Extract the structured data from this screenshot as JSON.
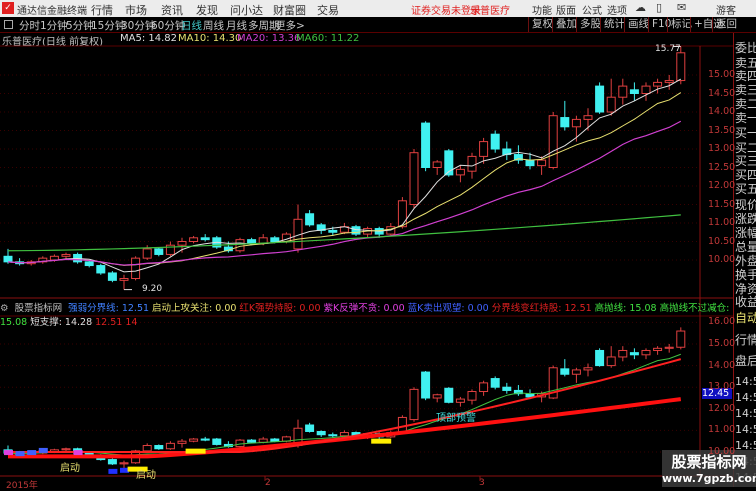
{
  "menubar": {
    "logo_icon": "tdx-logo-icon",
    "app_title": "通达信金融终端",
    "menus": [
      "行情",
      "市场",
      "资讯",
      "发现",
      "问小达",
      "财富圈",
      "交易"
    ],
    "login_status": "证券交易未登录",
    "stock_name": "乐普医疗",
    "right_menus": [
      "功能",
      "版面",
      "公式",
      "选项"
    ],
    "icons": [
      "cloud-icon",
      "phone-icon",
      "message-icon"
    ],
    "user": "游客"
  },
  "toolbar": {
    "periods": [
      "分时",
      "1分钟",
      "5分钟",
      "15分钟",
      "30分钟",
      "60分钟",
      "日线",
      "周线",
      "月线",
      "多周期",
      "更多>"
    ],
    "active_period": "日线",
    "buttons": [
      "复权",
      "叠加",
      "多股",
      "统计",
      "画线",
      "F10",
      "标记",
      "+自选",
      "返回"
    ]
  },
  "info": {
    "title": "乐普医疗(日线 前复权)",
    "ma5": "MA5: 14.82",
    "ma10": "MA10: 14.30",
    "ma20": "MA20: 13.36",
    "ma60": "MA60: 11.22"
  },
  "colors": {
    "up": "#e04040",
    "down": "#40f0f0",
    "ma5": "#e0e0e0",
    "ma10": "#e8e070",
    "ma20": "#d040d0",
    "ma60": "#40c040",
    "axis": "#c03838",
    "grid": "#3a0000"
  },
  "right_panel": {
    "top": [
      "委比",
      "卖五",
      "卖四",
      "卖三",
      "卖二",
      "卖一",
      "买一",
      "买二",
      "买三",
      "买四",
      "买五",
      "现价",
      "涨跌",
      "涨幅",
      "总量",
      "外盘",
      "换手",
      "净资",
      "收益"
    ],
    "bottom": [
      "自动",
      "行情",
      "盘后"
    ],
    "times": [
      "14:56",
      "14:56",
      "14:56",
      "14:56",
      "14:56",
      "14:56",
      "14:57",
      "15:00"
    ]
  },
  "indicator": {
    "name": "股票指标网",
    "items": [
      {
        "t": "强弱分界线: 12.51",
        "c": "#4080ff"
      },
      {
        "t": "启动上攻关注: 0.00",
        "c": "#e8e070"
      },
      {
        "t": "红K强势持股: 0.00",
        "c": "#e02020"
      },
      {
        "t": "紫K反弹不贪: 0.00",
        "c": "#e040e0"
      },
      {
        "t": "蓝K卖出观望: 0.00",
        "c": "#4060ff"
      },
      {
        "t": "分界线变红持股: 12.51",
        "c": "#e02020"
      },
      {
        "t": "高抛线: 15.08",
        "c": "#40e040"
      },
      {
        "t": "高抛线不过减仓: 15.08",
        "c": "#40e040"
      },
      {
        "t": "短支撑: 14.28",
        "c": "#e0e0e0"
      },
      {
        "t": "12.51",
        "c": "#e02020"
      },
      {
        "t": "14",
        "c": "#e02020"
      }
    ],
    "labels": {
      "start": "启动",
      "warning": "顶部预警"
    },
    "current_box": "12.45"
  },
  "x_axis": [
    "2015年",
    "2",
    "3"
  ],
  "watermark": {
    "name": "股票指标网",
    "url": "www.7gpzb.com"
  },
  "chart_data": [
    {
      "type": "candlestick",
      "title": "乐普医疗(日线 前复权)",
      "ylim": [
        9.0,
        15.9
      ],
      "yticks": [
        10.0,
        10.5,
        11.0,
        11.5,
        12.0,
        12.5,
        13.0,
        13.5,
        14.0,
        14.5,
        15.0
      ],
      "annotations": {
        "high": "15.77",
        "low": "9.20"
      },
      "ohlc": [
        [
          10.1,
          10.3,
          9.9,
          9.95
        ],
        [
          9.95,
          10.05,
          9.85,
          9.9
        ],
        [
          9.9,
          10.0,
          9.85,
          9.95
        ],
        [
          9.95,
          10.1,
          9.9,
          10.05
        ],
        [
          10.0,
          10.15,
          9.95,
          10.1
        ],
        [
          10.1,
          10.2,
          10.0,
          10.15
        ],
        [
          10.15,
          10.2,
          9.9,
          9.95
        ],
        [
          9.95,
          10.0,
          9.8,
          9.85
        ],
        [
          9.85,
          9.9,
          9.6,
          9.65
        ],
        [
          9.65,
          9.7,
          9.4,
          9.45
        ],
        [
          9.45,
          9.6,
          9.2,
          9.5
        ],
        [
          9.5,
          10.1,
          9.45,
          10.05
        ],
        [
          10.05,
          10.4,
          10.0,
          10.3
        ],
        [
          10.3,
          10.35,
          10.1,
          10.15
        ],
        [
          10.15,
          10.5,
          10.1,
          10.4
        ],
        [
          10.4,
          10.6,
          10.2,
          10.5
        ],
        [
          10.5,
          10.65,
          10.45,
          10.6
        ],
        [
          10.6,
          10.7,
          10.5,
          10.55
        ],
        [
          10.6,
          10.65,
          10.3,
          10.35
        ],
        [
          10.35,
          10.5,
          10.2,
          10.25
        ],
        [
          10.25,
          10.6,
          10.2,
          10.55
        ],
        [
          10.55,
          10.6,
          10.4,
          10.45
        ],
        [
          10.45,
          10.7,
          10.4,
          10.6
        ],
        [
          10.6,
          10.65,
          10.45,
          10.5
        ],
        [
          10.5,
          10.75,
          10.45,
          10.7
        ],
        [
          10.3,
          11.5,
          10.2,
          11.1
        ],
        [
          11.25,
          11.35,
          10.9,
          10.95
        ],
        [
          10.95,
          11.0,
          10.7,
          10.8
        ],
        [
          10.8,
          10.9,
          10.65,
          10.75
        ],
        [
          10.75,
          11.0,
          10.7,
          10.9
        ],
        [
          10.9,
          10.95,
          10.65,
          10.7
        ],
        [
          10.7,
          10.9,
          10.6,
          10.85
        ],
        [
          10.85,
          10.9,
          10.6,
          10.7
        ],
        [
          10.7,
          11.0,
          10.65,
          10.9
        ],
        [
          10.9,
          11.7,
          10.85,
          11.6
        ],
        [
          11.5,
          13.0,
          11.4,
          12.9
        ],
        [
          13.7,
          13.75,
          12.4,
          12.5
        ],
        [
          12.5,
          12.7,
          12.3,
          12.65
        ],
        [
          12.95,
          13.0,
          12.25,
          12.3
        ],
        [
          12.3,
          12.55,
          12.1,
          12.45
        ],
        [
          12.4,
          12.9,
          12.2,
          12.8
        ],
        [
          12.8,
          13.3,
          12.6,
          13.2
        ],
        [
          13.4,
          13.5,
          12.9,
          13.0
        ],
        [
          13.0,
          13.2,
          12.7,
          12.85
        ],
        [
          12.85,
          13.1,
          12.6,
          12.7
        ],
        [
          12.7,
          12.9,
          12.45,
          12.55
        ],
        [
          12.55,
          12.8,
          12.3,
          12.7
        ],
        [
          12.5,
          14.0,
          12.45,
          13.9
        ],
        [
          13.85,
          14.3,
          13.5,
          13.6
        ],
        [
          13.6,
          13.9,
          13.2,
          13.8
        ],
        [
          13.8,
          14.1,
          13.5,
          13.9
        ],
        [
          14.7,
          14.8,
          13.95,
          14.0
        ],
        [
          14.0,
          14.9,
          13.9,
          14.4
        ],
        [
          14.4,
          14.9,
          14.2,
          14.7
        ],
        [
          14.6,
          14.8,
          14.3,
          14.5
        ],
        [
          14.5,
          14.8,
          14.3,
          14.7
        ],
        [
          14.7,
          14.9,
          14.5,
          14.8
        ],
        [
          14.8,
          15.0,
          14.6,
          14.85
        ],
        [
          14.85,
          15.77,
          14.75,
          15.6
        ]
      ]
    },
    {
      "type": "indicator",
      "ylim": [
        9.0,
        16.5
      ],
      "yticks": [
        10.0,
        11.0,
        12.0,
        13.0,
        14.0,
        15.0,
        16.0
      ],
      "support_line_start": 9.8,
      "support_line_end": 12.45,
      "high_line_start": 10.0,
      "high_line_end": 14.3
    }
  ]
}
